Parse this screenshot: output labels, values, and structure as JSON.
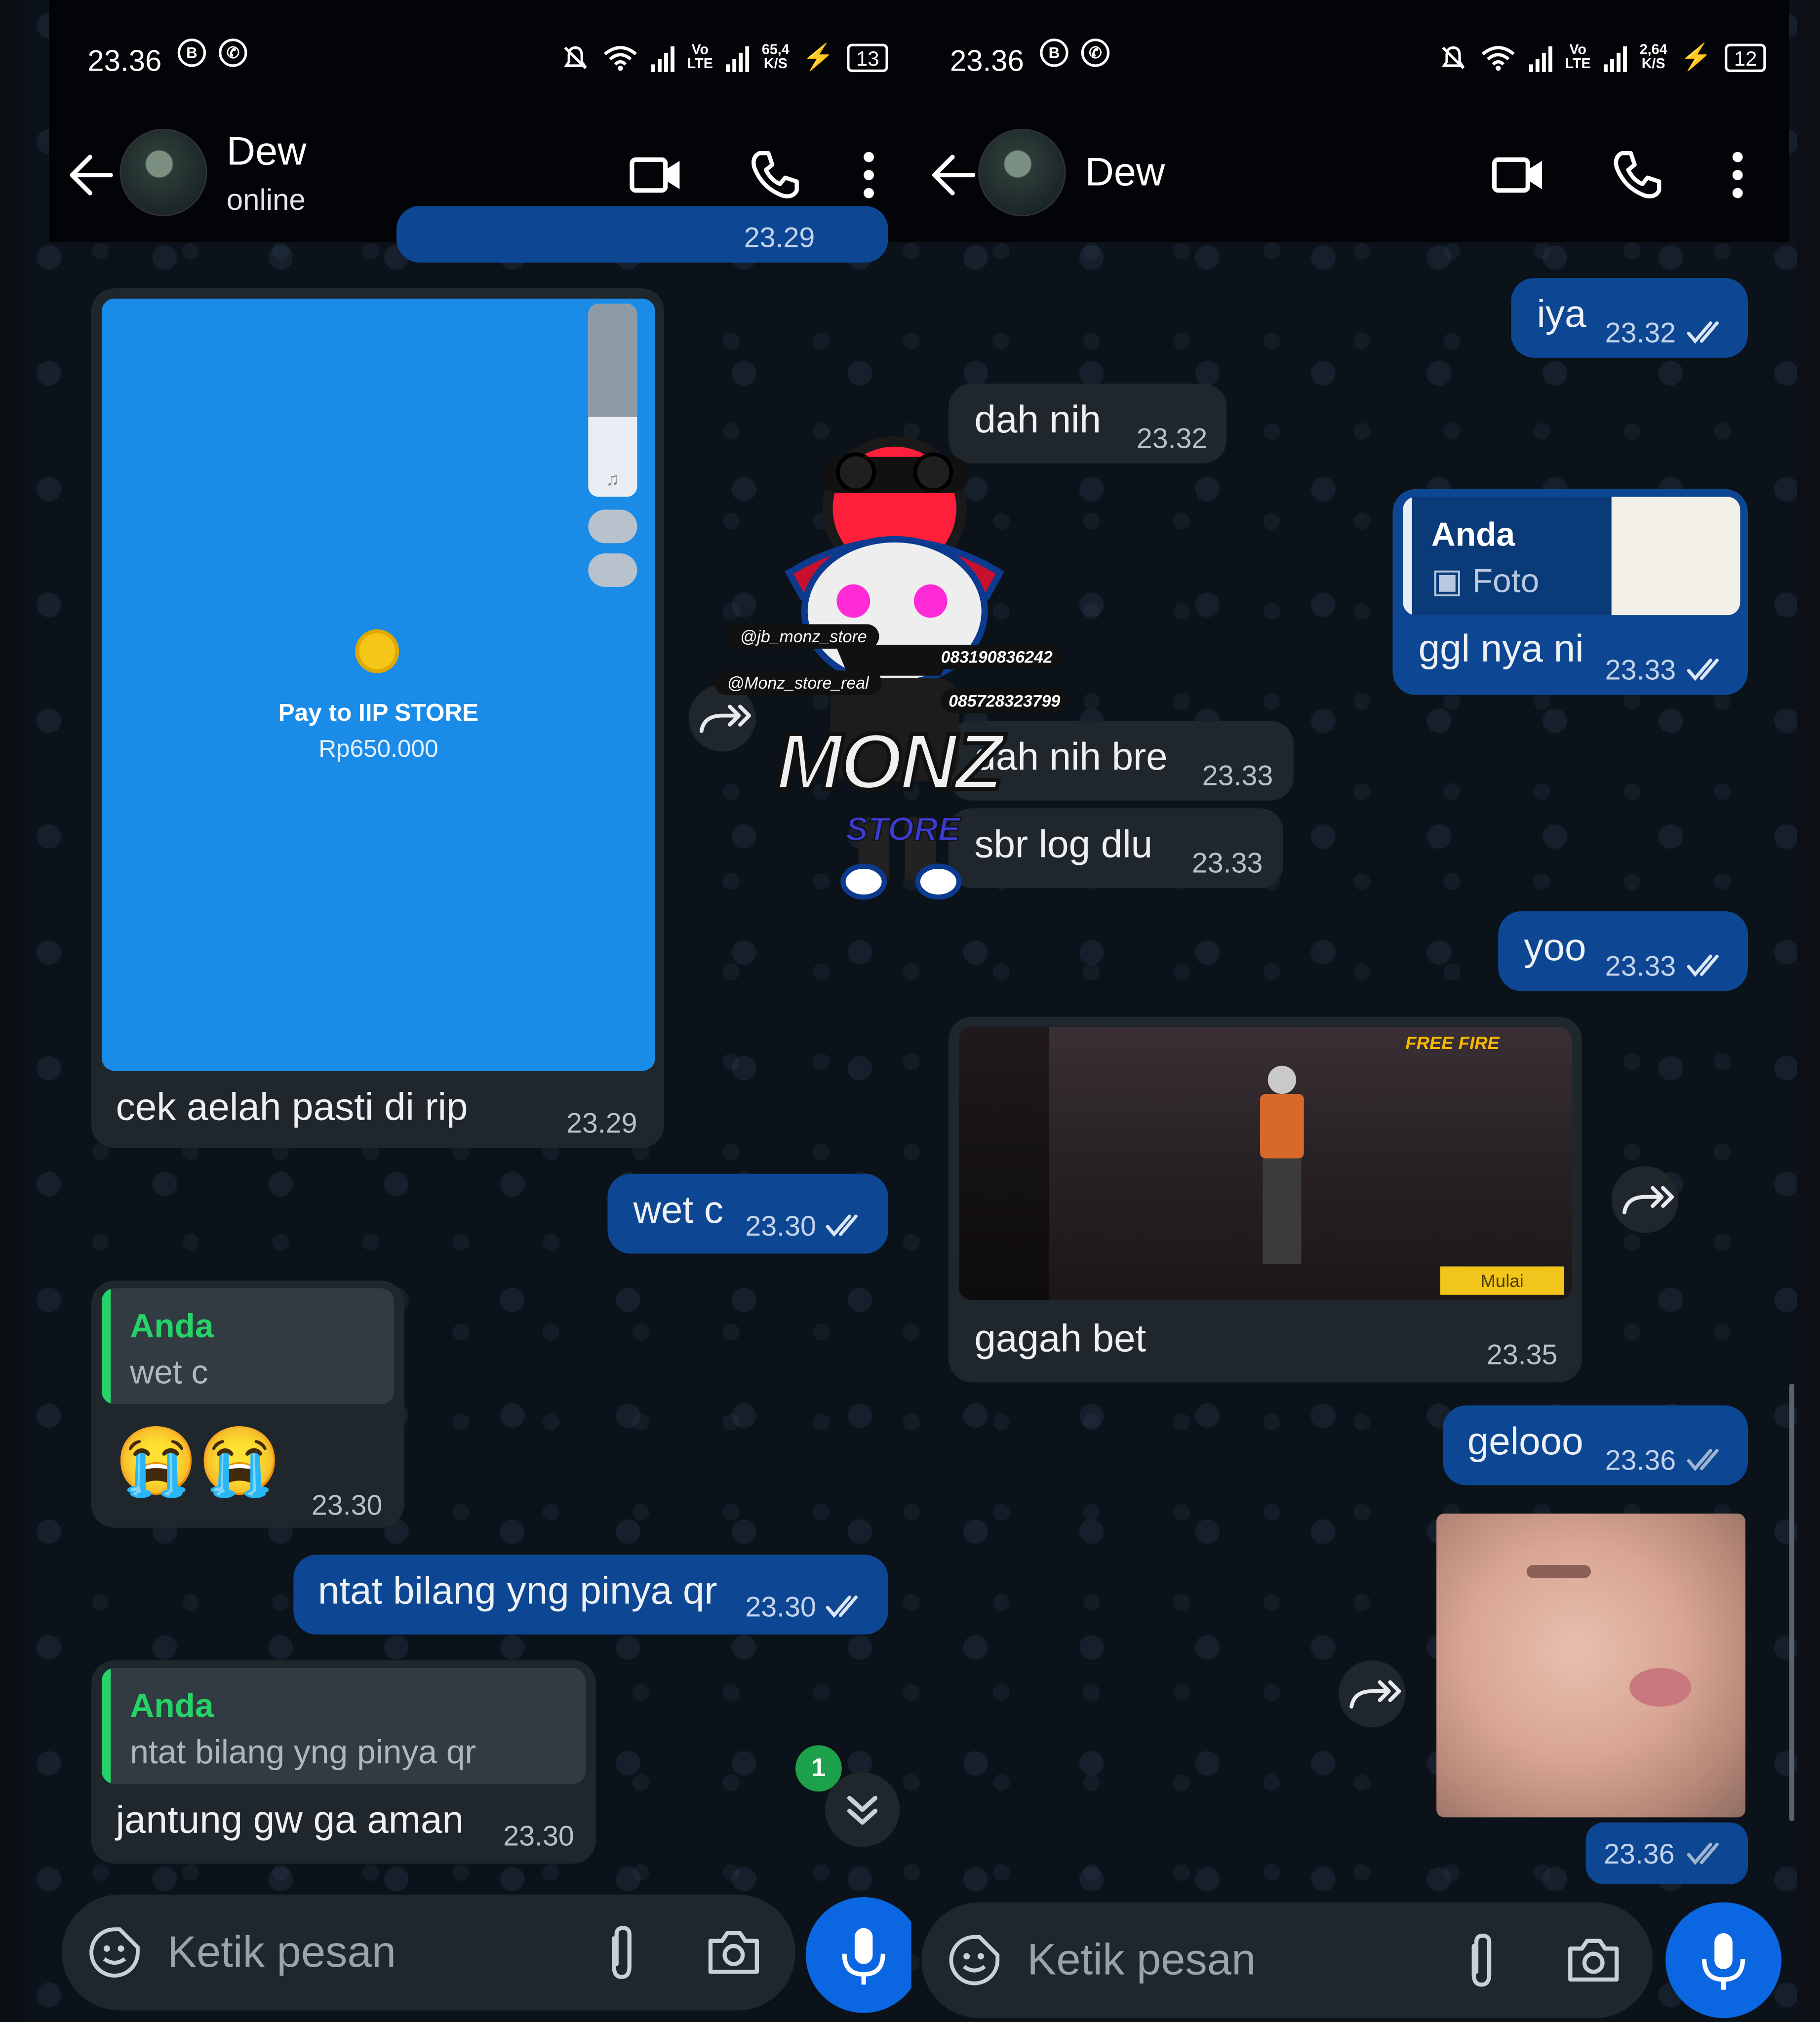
{
  "left": {
    "status": {
      "time": "23.36",
      "net_speed": "65,4",
      "net_unit": "K/S",
      "volte_top": "Vo",
      "volte_bottom": "LTE",
      "battery": "13"
    },
    "header": {
      "name": "Dew",
      "subtitle": "online"
    },
    "messages": {
      "top_time": "23.29",
      "payment": {
        "pay_text": "Pay to IIP STORE",
        "amount": "Rp650.000",
        "caption": "cek aelah pasti di rip",
        "time": "23.29"
      },
      "m_wetc": {
        "text": "wet c",
        "time": "23.30"
      },
      "r1": {
        "quote_author": "Anda",
        "quote_text": "wet c",
        "emoji": "😭😭",
        "time": "23.30"
      },
      "m_ntat": {
        "text": "ntat bilang yng pinya qr",
        "time": "23.30"
      },
      "r2": {
        "quote_author": "Anda",
        "quote_text": "ntat bilang yng pinya qr",
        "text": "jantung gw ga aman",
        "time": "23.30"
      }
    },
    "unread_badge": "1",
    "input_placeholder": "Ketik pesan"
  },
  "right": {
    "status": {
      "time": "23.36",
      "net_speed": "2,64",
      "net_unit": "K/S",
      "volte_top": "Vo",
      "volte_bottom": "LTE",
      "battery": "12"
    },
    "header": {
      "name": "Dew"
    },
    "messages": {
      "iya": {
        "text": "iya",
        "time": "23.32"
      },
      "dah": {
        "text": "dah nih",
        "time": "23.32"
      },
      "ggl": {
        "quote_author": "Anda",
        "quote_label": "Foto",
        "text": "ggl nya ni",
        "time": "23.33"
      },
      "bre": {
        "text": "dah nih bre",
        "time": "23.33"
      },
      "sbr": {
        "text": "sbr log dlu",
        "time": "23.33"
      },
      "yoo": {
        "text": "yoo",
        "time": "23.33"
      },
      "game": {
        "caption": "gagah bet",
        "time": "23.35",
        "game_logo": "FREE FIRE",
        "start": "Mulai"
      },
      "gelooo": {
        "text": "gelooo",
        "time": "23.36"
      },
      "photo": {
        "time": "23.36"
      }
    },
    "input_placeholder": "Ketik pesan"
  },
  "sticker": {
    "handle_tiktok": "@jb_monz_store",
    "handle_ig": "@Monz_store_real",
    "wa1": "083190836242",
    "wa2": "085728323799",
    "brand": "MONZ",
    "brand_sub": "STORE"
  },
  "colors": {
    "outgoing": "#0d4793",
    "incoming": "#1f262c",
    "accent": "#0b66e2",
    "quote_bar": "#25d366",
    "header": "#020407"
  }
}
